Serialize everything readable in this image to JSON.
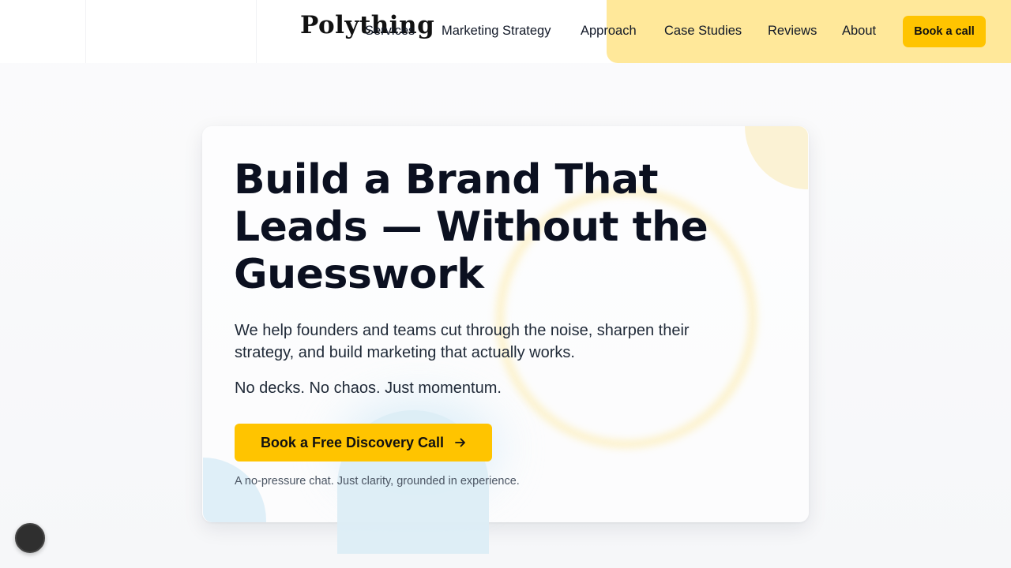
{
  "header": {
    "logo": "Polything",
    "nav": [
      {
        "label": "Services"
      },
      {
        "label": "Marketing Strategy"
      },
      {
        "label": "Approach"
      },
      {
        "label": "Case Studies"
      },
      {
        "label": "Reviews"
      },
      {
        "label": "About"
      }
    ],
    "cta_label": "Book a call"
  },
  "hero": {
    "title": "Build a Brand That Leads — Without the Guesswork",
    "subtitle": "We help founders and teams cut through the noise, sharpen their strategy, and build marketing that actually works.",
    "tagline": "No decks. No chaos. Just momentum.",
    "cta_label": "Book a Free Discovery Call",
    "cta_icon": "arrow-right-icon",
    "note": "A no-pressure chat. Just clarity, grounded in experience."
  },
  "widgets": {
    "chat_icon": "chat-bubble-icon"
  },
  "colors": {
    "accent": "#ffc400",
    "accent_soft": "#ffe89a",
    "text_dark": "#0b1020",
    "blue_soft": "#dcedf7"
  }
}
